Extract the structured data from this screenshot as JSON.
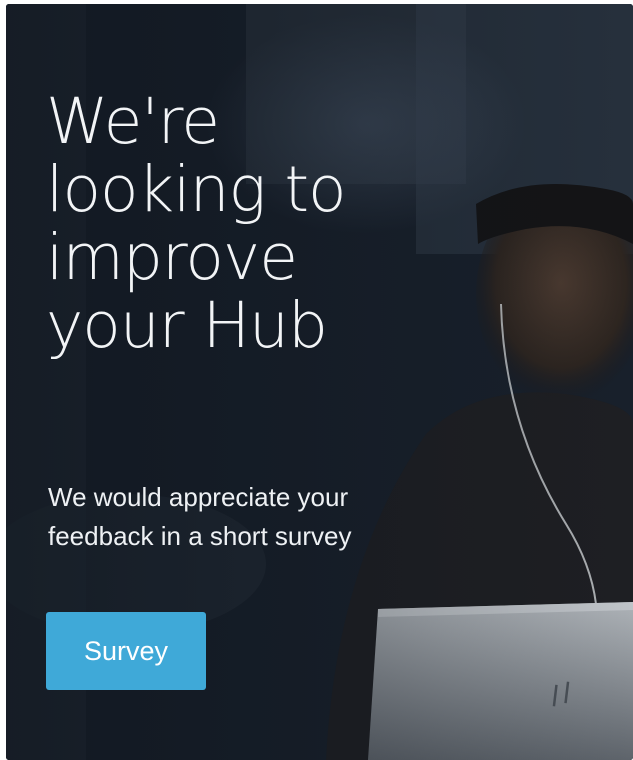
{
  "banner": {
    "headline_lines": [
      "We're",
      "looking to",
      "improve",
      "your Hub"
    ],
    "subtext_lines": [
      "We would appreciate your",
      "feedback in a short survey"
    ],
    "button_label": "Survey"
  },
  "colors": {
    "background": "#151c26",
    "headline_text": "#f2f4f6",
    "button": "#3fa9d8",
    "button_text": "#ffffff"
  },
  "icons": {
    "laptop_logo": "hp-logo"
  }
}
